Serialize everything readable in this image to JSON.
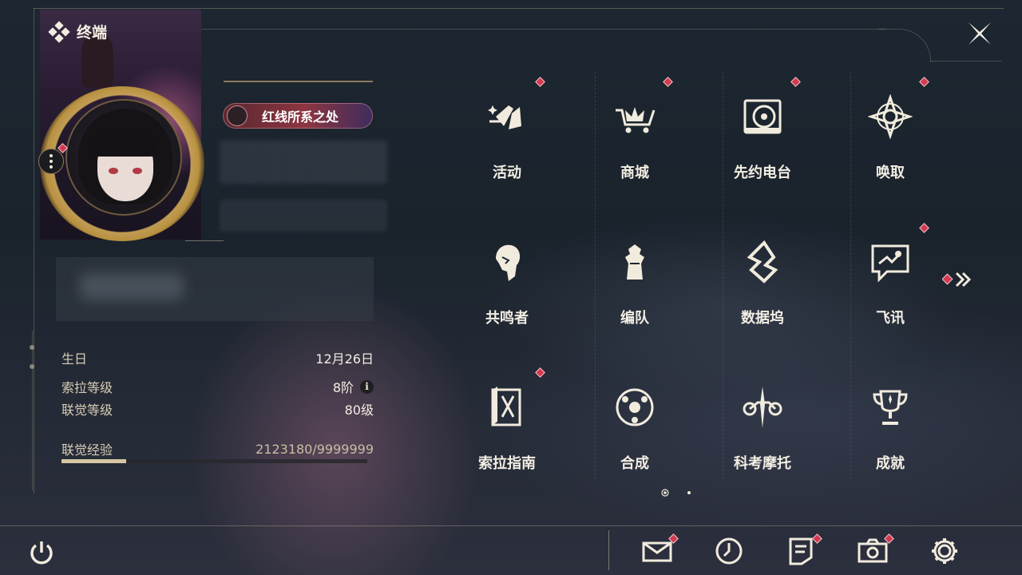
{
  "header": {
    "title": "终端"
  },
  "profile": {
    "badge_name": "红线所系之处",
    "stats": [
      {
        "label": "生日",
        "value": "12月26日"
      },
      {
        "label": "索拉等级",
        "value": "8阶"
      },
      {
        "label": "联觉等级",
        "value": "80级"
      }
    ],
    "exp": {
      "label": "联觉经验",
      "value": "2123180/9999999",
      "progress": 0.2123
    }
  },
  "menu": [
    {
      "label": "活动",
      "icon": "activity-icon",
      "badge": true
    },
    {
      "label": "商城",
      "icon": "shop-crown-cart-icon",
      "badge": true
    },
    {
      "label": "先约电台",
      "icon": "radio-disc-icon",
      "badge": true
    },
    {
      "label": "唤取",
      "icon": "summon-star-icon",
      "badge": true
    },
    {
      "label": "共鸣者",
      "icon": "resonator-head-icon",
      "badge": false
    },
    {
      "label": "编队",
      "icon": "team-chess-icon",
      "badge": false
    },
    {
      "label": "数据坞",
      "icon": "data-dock-icon",
      "badge": false
    },
    {
      "label": "飞讯",
      "icon": "message-bubble-icon",
      "badge": true
    },
    {
      "label": "索拉指南",
      "icon": "guide-book-icon",
      "badge": true
    },
    {
      "label": "合成",
      "icon": "synthesis-icon",
      "badge": false
    },
    {
      "label": "科考摩托",
      "icon": "motorbike-icon",
      "badge": false
    },
    {
      "label": "成就",
      "icon": "trophy-icon",
      "badge": false
    }
  ],
  "pagination": {
    "current": 1,
    "total": 2
  },
  "bottom_bar": [
    {
      "name": "mail",
      "icon": "mail-icon",
      "badge": true
    },
    {
      "name": "clock",
      "icon": "clock-icon",
      "badge": false
    },
    {
      "name": "notes",
      "icon": "notes-icon",
      "badge": true
    },
    {
      "name": "camera",
      "icon": "camera-icon",
      "badge": true
    },
    {
      "name": "settings",
      "icon": "gear-icon",
      "badge": false
    }
  ],
  "colors": {
    "accent": "#d23a50",
    "gold": "#b8913f",
    "text": "#f3eee3"
  }
}
